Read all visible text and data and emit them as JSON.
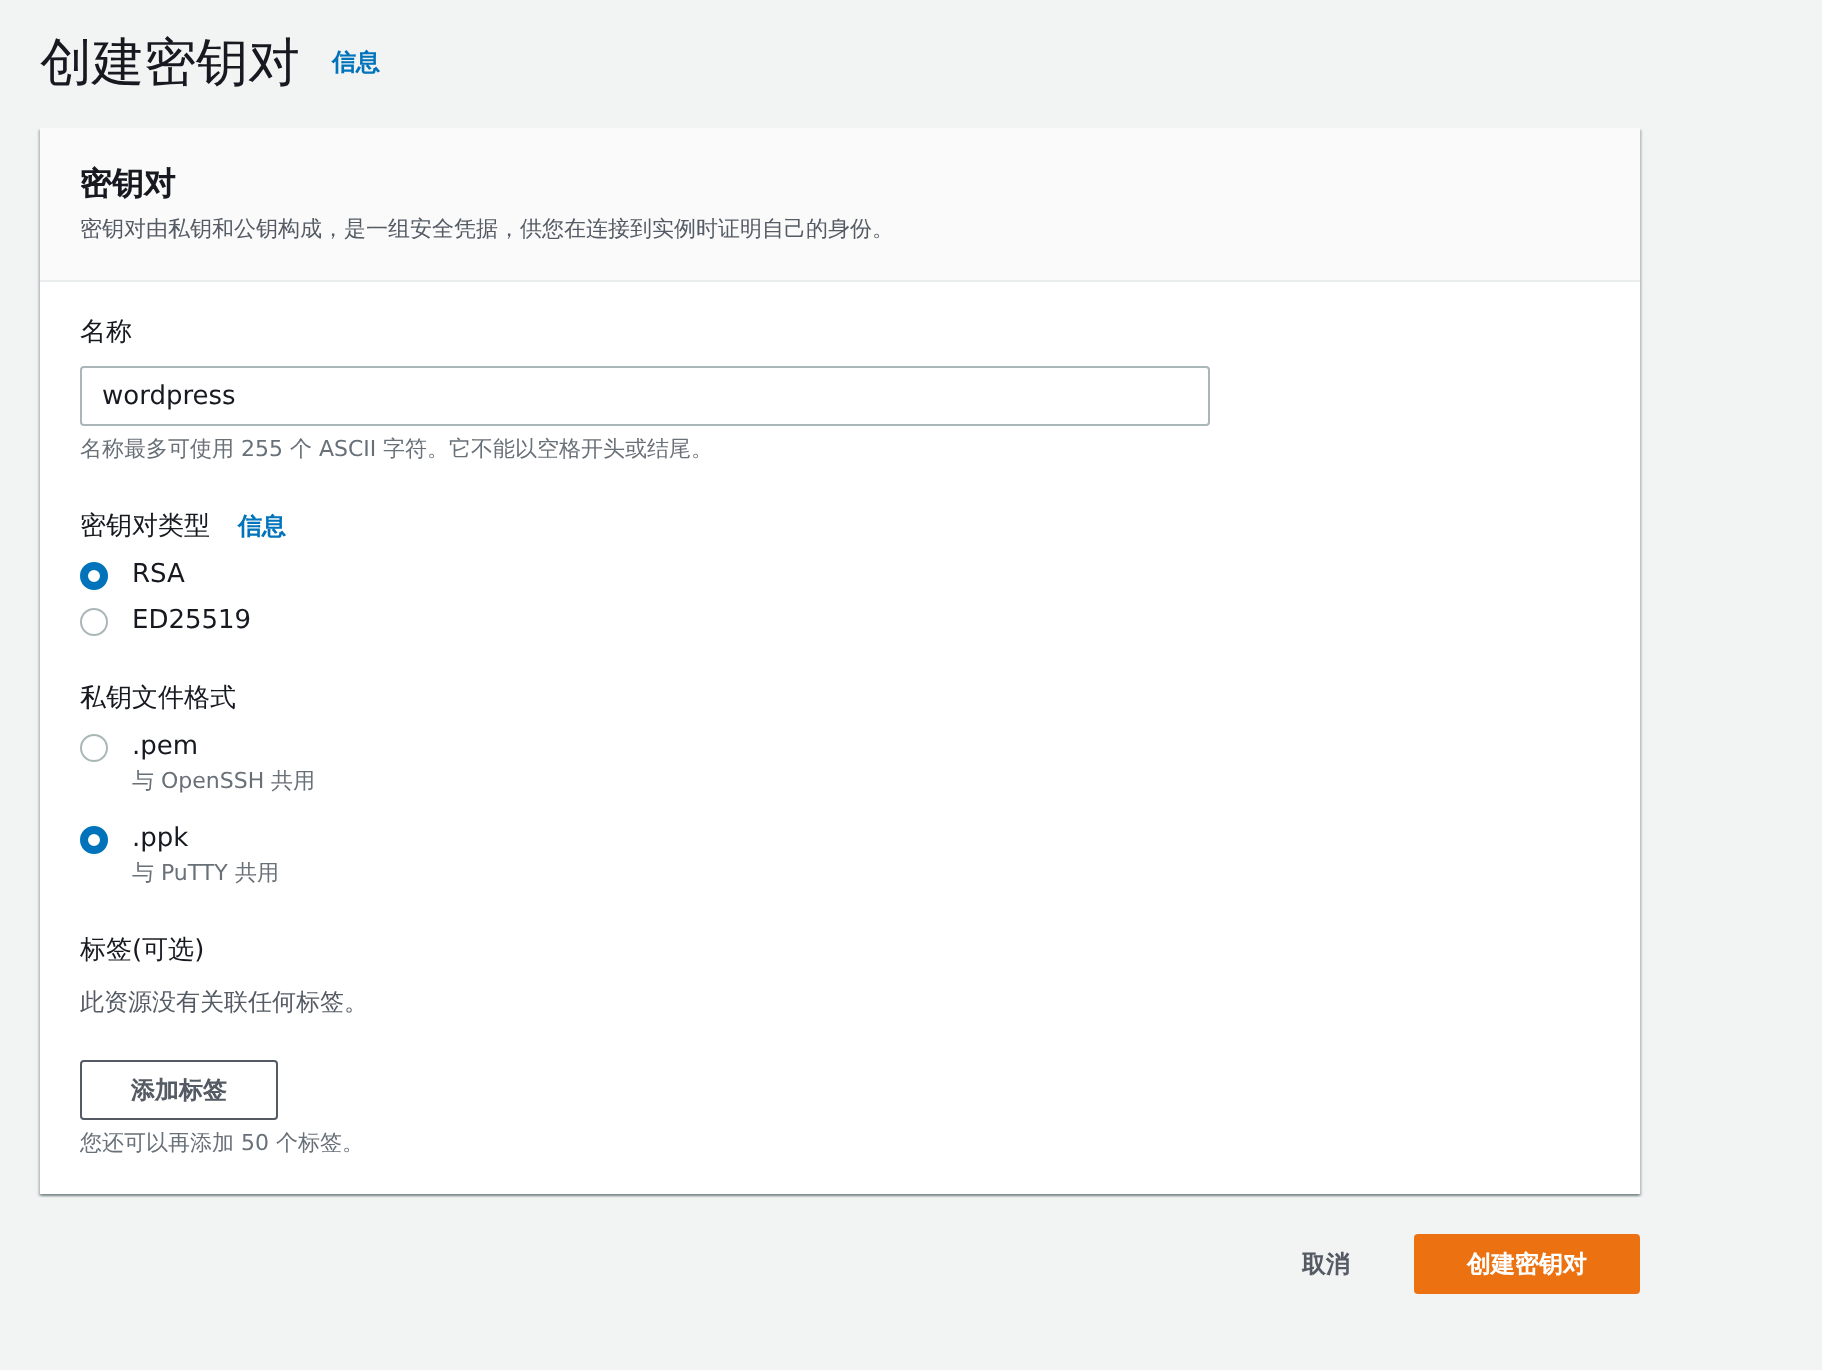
{
  "page": {
    "title": "创建密钥对",
    "info_link": "信息"
  },
  "card": {
    "title": "密钥对",
    "description": "密钥对由私钥和公钥构成，是一组安全凭据，供您在连接到实例时证明自己的身份。"
  },
  "name_field": {
    "label": "名称",
    "value": "wordpress",
    "hint": "名称最多可使用 255 个 ASCII 字符。它不能以空格开头或结尾。"
  },
  "key_type": {
    "label": "密钥对类型",
    "info_link": "信息",
    "options": [
      {
        "label": "RSA",
        "selected": true
      },
      {
        "label": "ED25519",
        "selected": false
      }
    ]
  },
  "file_format": {
    "label": "私钥文件格式",
    "options": [
      {
        "label": ".pem",
        "description": "与 OpenSSH 共用",
        "selected": false
      },
      {
        "label": ".ppk",
        "description": "与 PuTTY 共用",
        "selected": true
      }
    ]
  },
  "tags": {
    "label": "标签(可选)",
    "empty_text": "此资源没有关联任何标签。",
    "add_button": "添加标签",
    "hint": "您还可以再添加 50 个标签。"
  },
  "footer": {
    "cancel": "取消",
    "submit": "创建密钥对"
  }
}
